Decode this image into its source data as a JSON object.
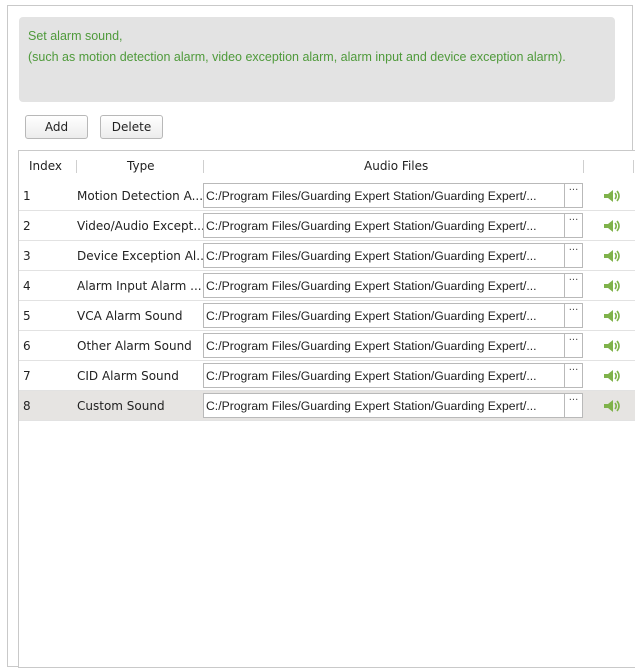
{
  "info": {
    "line1": "Set alarm sound,",
    "line2": "(such as motion detection alarm, video exception alarm, alarm input and device exception alarm)."
  },
  "toolbar": {
    "add_label": "Add",
    "delete_label": "Delete"
  },
  "table": {
    "columns": {
      "index": "Index",
      "type": "Type",
      "audio": "Audio Files"
    },
    "rows": [
      {
        "index": "1",
        "type": "Motion Detection A...",
        "path": "C:/Program Files/Guarding Expert Station/Guarding Expert/..."
      },
      {
        "index": "2",
        "type": "Video/Audio Except...",
        "path": "C:/Program Files/Guarding Expert Station/Guarding Expert/..."
      },
      {
        "index": "3",
        "type": "Device Exception Al...",
        "path": "C:/Program Files/Guarding Expert Station/Guarding Expert/..."
      },
      {
        "index": "4",
        "type": "Alarm Input Alarm ...",
        "path": "C:/Program Files/Guarding Expert Station/Guarding Expert/..."
      },
      {
        "index": "5",
        "type": "VCA Alarm Sound",
        "path": "C:/Program Files/Guarding Expert Station/Guarding Expert/..."
      },
      {
        "index": "6",
        "type": "Other Alarm Sound",
        "path": "C:/Program Files/Guarding Expert Station/Guarding Expert/..."
      },
      {
        "index": "7",
        "type": "CID Alarm Sound",
        "path": "C:/Program Files/Guarding Expert Station/Guarding Expert/..."
      },
      {
        "index": "8",
        "type": "Custom Sound",
        "path": "C:/Program Files/Guarding Expert Station/Guarding Expert/..."
      }
    ],
    "browse_label": "···",
    "selected_row": 8
  },
  "colors": {
    "info_text": "#4f9a3b",
    "play_icon": "#7fb24a",
    "selected_row": "#e6e4e2"
  },
  "icons": {
    "browse": "ellipsis-icon",
    "play": "speaker-icon"
  }
}
